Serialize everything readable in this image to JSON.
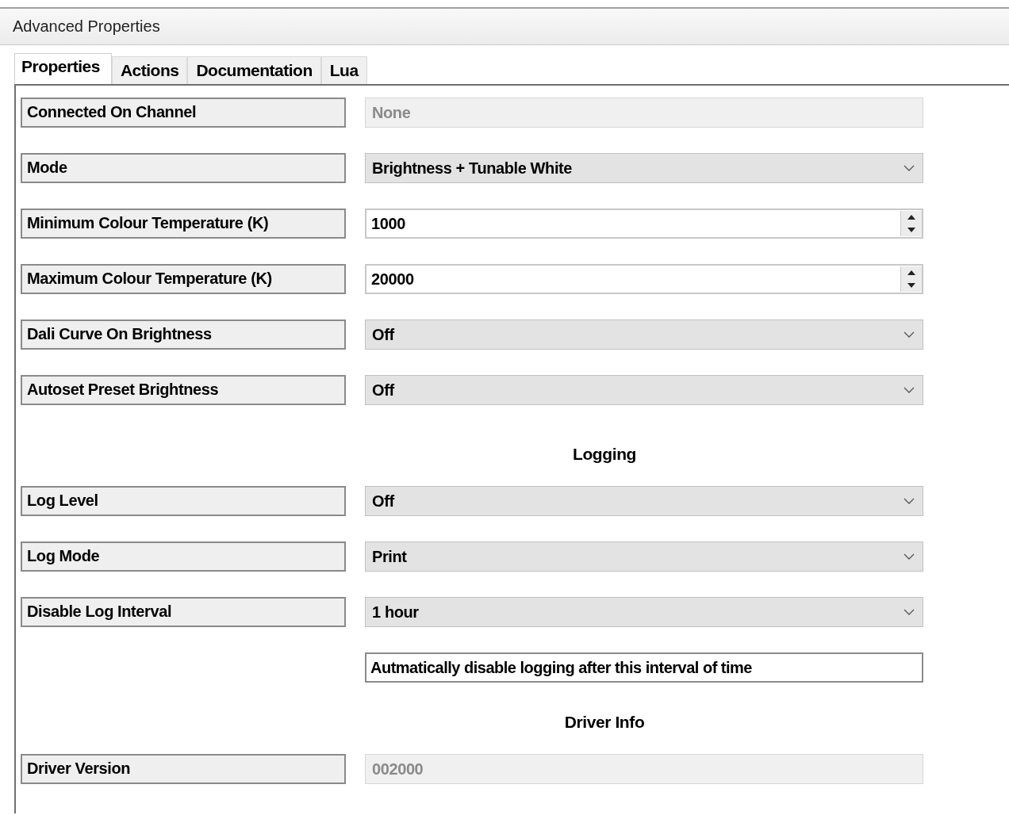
{
  "window": {
    "title": "Advanced Properties"
  },
  "tabs": [
    {
      "label": "Properties",
      "selected": true
    },
    {
      "label": "Actions",
      "selected": false
    },
    {
      "label": "Documentation",
      "selected": false
    },
    {
      "label": "Lua",
      "selected": false
    }
  ],
  "items": [
    {
      "kind": "readonly",
      "label": "Connected On Channel",
      "value": "None"
    },
    {
      "kind": "dropdown",
      "label": "Mode",
      "value": "Brightness + Tunable White"
    },
    {
      "kind": "spinner",
      "label": "Minimum Colour Temperature (K)",
      "value": "1000"
    },
    {
      "kind": "spinner",
      "label": "Maximum Colour Temperature (K)",
      "value": "20000"
    },
    {
      "kind": "dropdown",
      "label": "Dali Curve On Brightness",
      "value": "Off"
    },
    {
      "kind": "dropdown",
      "label": "Autoset Preset Brightness",
      "value": "Off"
    },
    {
      "kind": "heading",
      "text": "Logging"
    },
    {
      "kind": "dropdown",
      "label": "Log Level",
      "value": "Off"
    },
    {
      "kind": "dropdown",
      "label": "Log Mode",
      "value": "Print"
    },
    {
      "kind": "dropdown",
      "label": "Disable Log Interval",
      "value": "1 hour"
    },
    {
      "kind": "note",
      "text": "Autmatically disable logging after this interval of time"
    },
    {
      "kind": "heading",
      "text": "Driver Info"
    },
    {
      "kind": "readonly",
      "label": "Driver Version",
      "value": "002000"
    }
  ]
}
